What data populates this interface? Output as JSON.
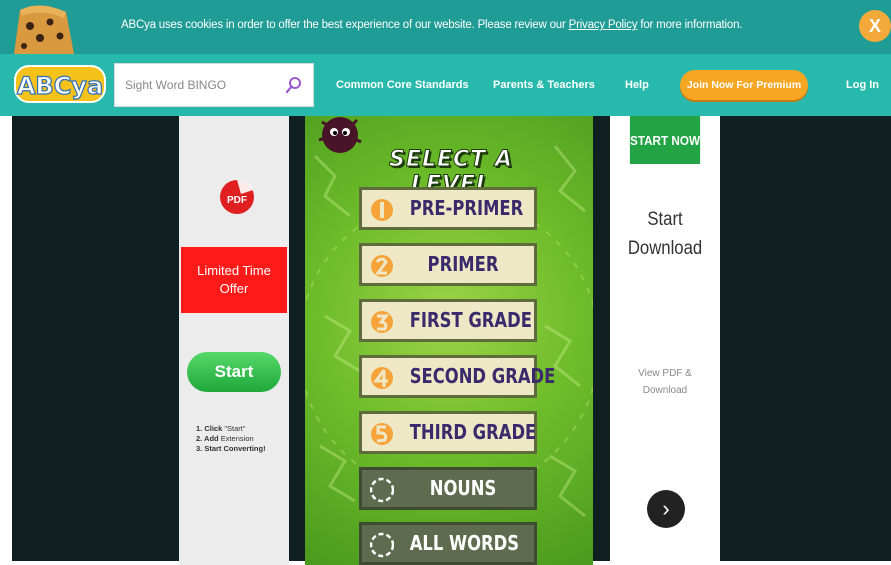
{
  "cookie_banner": {
    "message_start": "ABCya uses cookies in order to offer the best experience of our website. Please review our ",
    "link": "Privacy Policy",
    "message_end": " for more information.",
    "close_label": "X"
  },
  "navbar": {
    "logo_text": "ABCya",
    "search_value": "Sight Word BINGO",
    "links": [
      "Common Core Standards",
      "Parents & Teachers",
      "Help"
    ],
    "premium_label": "Join Now For Premium",
    "login_label": "Log In"
  },
  "ad_left": {
    "icon_label": "PDF",
    "offer_line1": "Limited Time",
    "offer_line2": "Offer",
    "start_label": "Start",
    "steps": [
      {
        "num": "1. Click",
        "text": " \"Start\""
      },
      {
        "num": "2. Add",
        "text": " Extension"
      },
      {
        "num": "3. Start Converting!",
        "text": ""
      }
    ]
  },
  "game": {
    "title": "SELECT A LEVEL",
    "levels": [
      {
        "num": "1",
        "label": "PRE-PRIMER"
      },
      {
        "num": "2",
        "label": "PRIMER"
      },
      {
        "num": "3",
        "label": "FIRST GRADE"
      },
      {
        "num": "4",
        "label": "SECOND GRADE"
      },
      {
        "num": "5",
        "label": "THIRD GRADE"
      },
      {
        "num": "",
        "label": "NOUNS"
      },
      {
        "num": "",
        "label": "ALL WORDS"
      }
    ]
  },
  "ad_right": {
    "start_now": "START NOW",
    "start_line1": "Start",
    "start_line2": "Download",
    "view_line1": "View PDF &",
    "view_line2": "Download",
    "next_glyph": "›"
  },
  "colors": {
    "banner": "#1f9c95",
    "nav": "#27b9ac",
    "premium": "#f5a623",
    "offer_red": "#ff1a1a",
    "start_green": "#22a344"
  }
}
